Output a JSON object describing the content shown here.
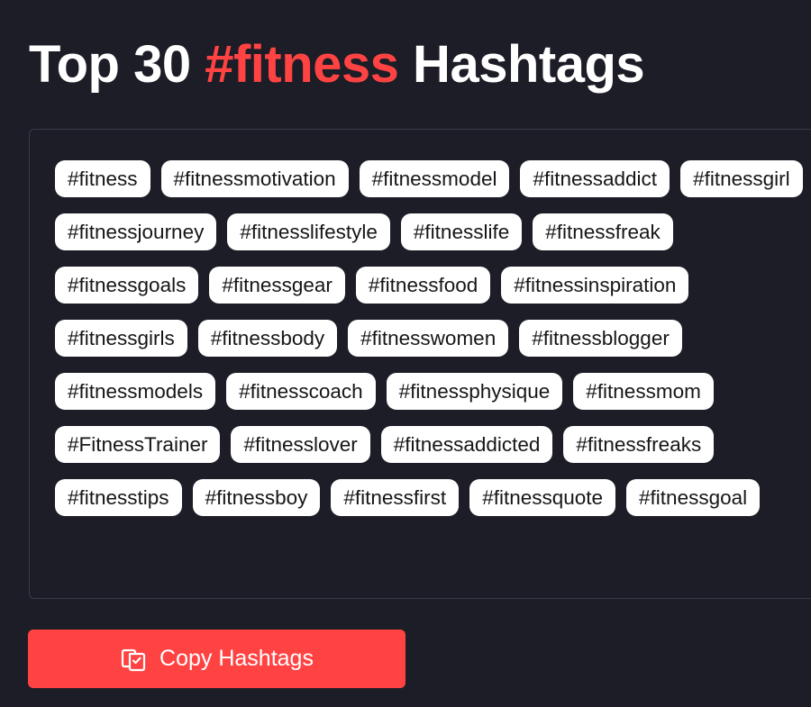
{
  "header": {
    "title_prefix": "Top 30 ",
    "title_highlight": "#fitness",
    "title_suffix": " Hashtags"
  },
  "hashtags": [
    "#fitness",
    "#fitnessmotivation",
    "#fitnessmodel",
    "#fitnessaddict",
    "#fitnessgirl",
    "#fitnessjourney",
    "#fitnesslifestyle",
    "#fitnesslife",
    "#fitnessfreak",
    "#fitnessgoals",
    "#fitnessgear",
    "#fitnessfood",
    "#fitnessinspiration",
    "#fitnessgirls",
    "#fitnessbody",
    "#fitnesswomen",
    "#fitnessblogger",
    "#fitnessmodels",
    "#fitnesscoach",
    "#fitnessphysique",
    "#fitnessmom",
    "#FitnessTrainer",
    "#fitnesslover",
    "#fitnessaddicted",
    "#fitnessfreaks",
    "#fitnesstips",
    "#fitnessboy",
    "#fitnessfirst",
    "#fitnessquote",
    "#fitnessgoal"
  ],
  "actions": {
    "copy_label": "Copy Hashtags",
    "copy_icon": "copy-icon"
  },
  "colors": {
    "background": "#1c1d27",
    "accent": "#ff4343",
    "tag_background": "#ffffff",
    "tag_text": "#161616",
    "panel_border": "#383a47"
  }
}
